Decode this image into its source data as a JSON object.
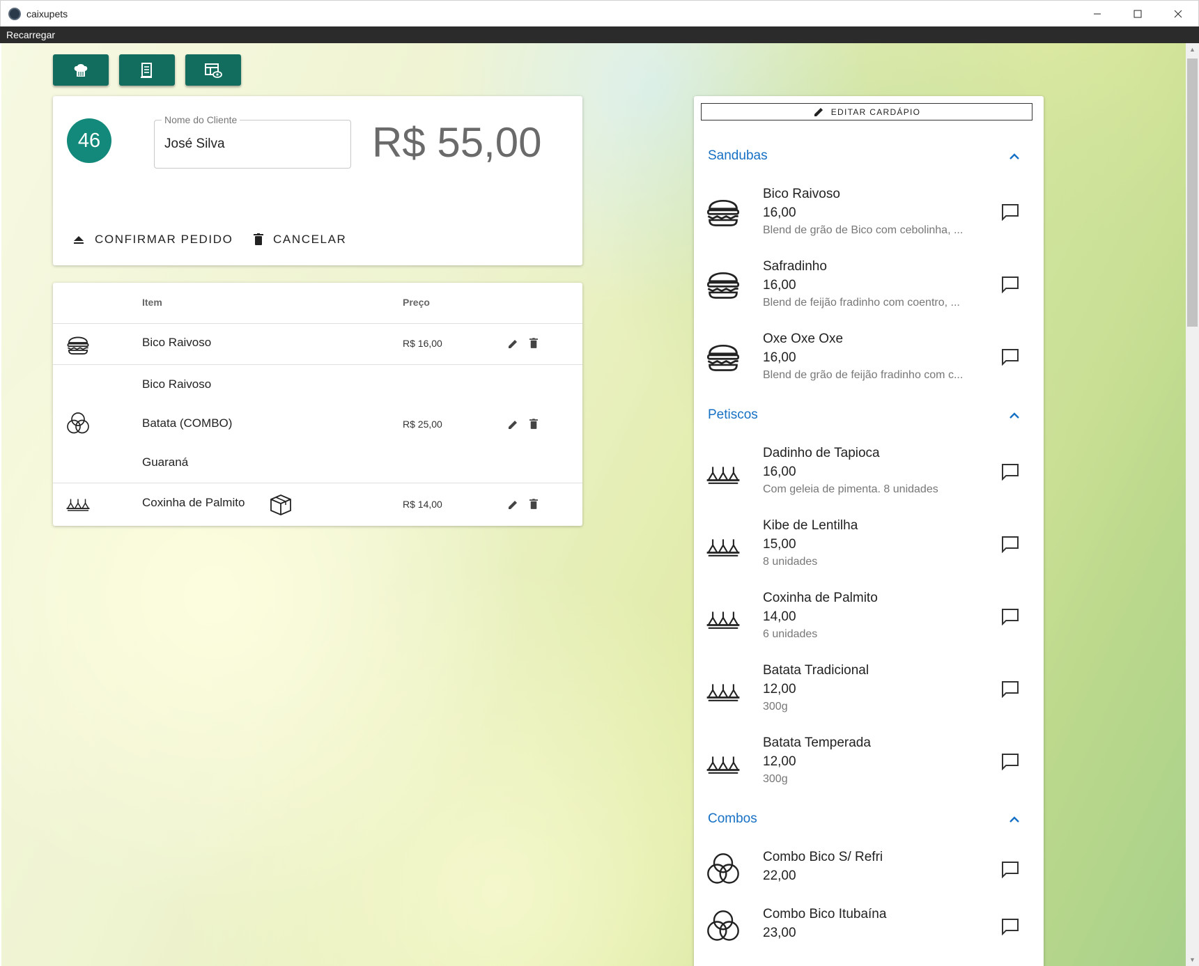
{
  "window": {
    "title": "caixupets"
  },
  "menu": {
    "reload": "Recarregar"
  },
  "order": {
    "number": "46",
    "client_label": "Nome do Cliente",
    "client_value": "José Silva",
    "total": "R$ 55,00",
    "confirm_label": "CONFIRMAR PEDIDO",
    "cancel_label": "CANCELAR"
  },
  "table": {
    "col_item": "Item",
    "col_price": "Preço",
    "rows": [
      {
        "items": [
          "Bico Raivoso"
        ],
        "price": "R$ 16,00",
        "icon": "burger-icon"
      },
      {
        "items": [
          "Bico Raivoso",
          "Batata (COMBO)",
          "Guaraná"
        ],
        "price": "R$ 25,00",
        "icon": "combo-icon"
      },
      {
        "items": [
          "Coxinha de Palmito"
        ],
        "price": "R$ 14,00",
        "icon": "snack-icon",
        "badge": "box-icon"
      }
    ]
  },
  "menu_panel": {
    "edit_label": "EDITAR CARDÁPIO",
    "categories": [
      {
        "name": "Sandubas",
        "items": [
          {
            "name": "Bico Raivoso",
            "price": "16,00",
            "desc": "Blend de grão de Bico com cebolinha, ..."
          },
          {
            "name": "Safradinho",
            "price": "16,00",
            "desc": "Blend de feijão fradinho com coentro, ..."
          },
          {
            "name": "Oxe Oxe Oxe",
            "price": "16,00",
            "desc": "Blend de grão de feijão fradinho com c..."
          }
        ]
      },
      {
        "name": "Petiscos",
        "items": [
          {
            "name": "Dadinho de Tapioca",
            "price": "16,00",
            "desc": "Com geleia de pimenta. 8 unidades"
          },
          {
            "name": "Kibe de Lentilha",
            "price": "15,00",
            "desc": "8 unidades"
          },
          {
            "name": "Coxinha de Palmito",
            "price": "14,00",
            "desc": "6 unidades"
          },
          {
            "name": "Batata Tradicional",
            "price": "12,00",
            "desc": "300g"
          },
          {
            "name": "Batata Temperada",
            "price": "12,00",
            "desc": "300g"
          }
        ]
      },
      {
        "name": "Combos",
        "items": [
          {
            "name": "Combo Bico S/ Refri",
            "price": "22,00"
          },
          {
            "name": "Combo Bico Itubaína",
            "price": "23,00"
          }
        ]
      }
    ]
  }
}
